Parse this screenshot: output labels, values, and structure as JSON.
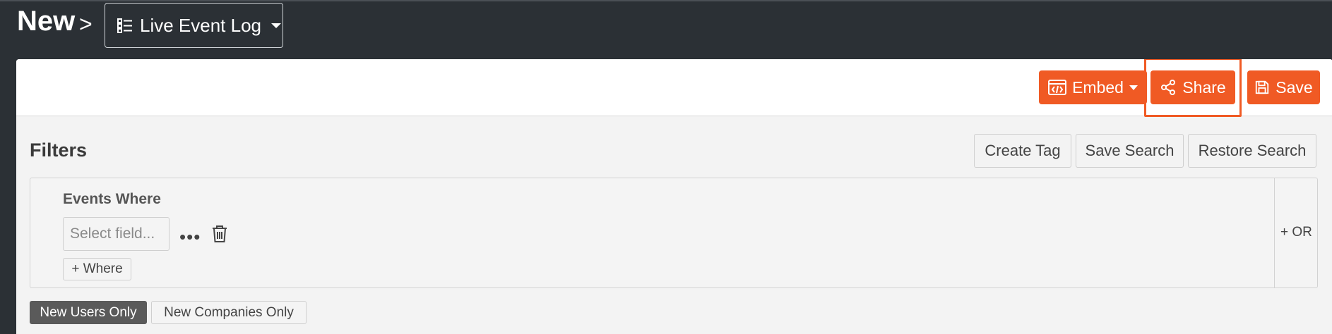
{
  "header": {
    "breadcrumb_root": "New",
    "separator": ">",
    "view_selector": {
      "label": "Live Event Log",
      "icon": "list-icon"
    }
  },
  "toolbar": {
    "embed_label": "Embed",
    "share_label": "Share",
    "save_label": "Save",
    "accent_color": "#f05a24"
  },
  "filters": {
    "title": "Filters",
    "create_tag_label": "Create Tag",
    "save_search_label": "Save Search",
    "restore_search_label": "Restore Search",
    "group": {
      "heading": "Events Where",
      "field_placeholder": "Select field...",
      "add_where_label": "+ Where",
      "or_label": "+ OR"
    },
    "scope_options": [
      {
        "label": "New Users Only",
        "active": true
      },
      {
        "label": "New Companies Only",
        "active": false
      }
    ]
  }
}
